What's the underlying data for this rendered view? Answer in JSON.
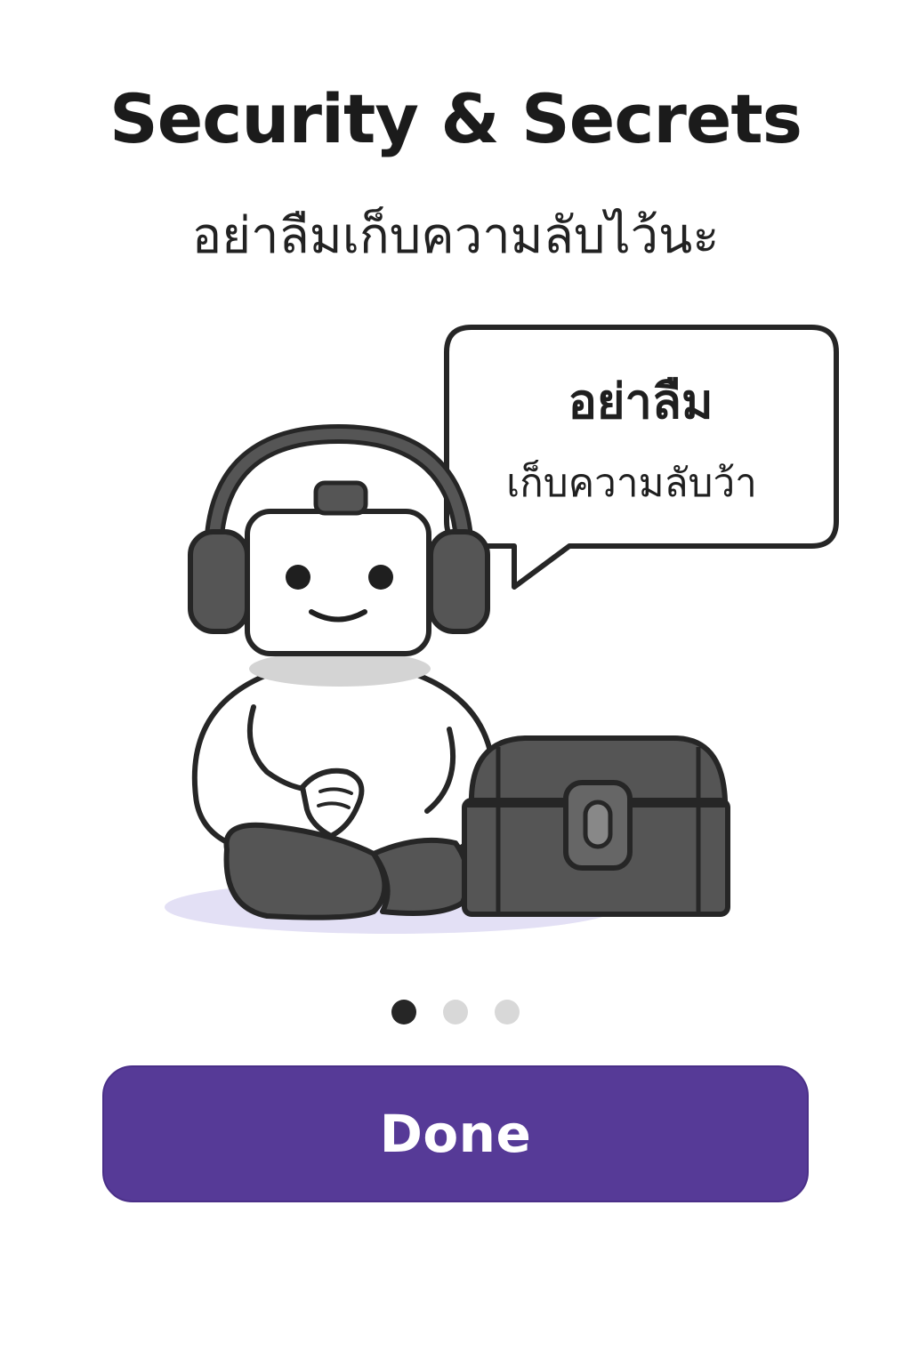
{
  "screen": {
    "title": "Security & Secrets",
    "subtitle": "อย่าลืมเก็บความลับไว้นะ"
  },
  "illustration": {
    "bubble_line_1": "อย่าลืม",
    "bubble_line_2": "เก็บความลับว้า",
    "icons": [
      "robot-character",
      "headphones-icon",
      "treasure-chest-icon",
      "speech-bubble"
    ]
  },
  "pagination": {
    "current": 1,
    "total": 3
  },
  "actions": {
    "done_label": "Done"
  },
  "colors": {
    "primary": "#563a97",
    "dot_active": "#262626",
    "dot_inactive": "#d8d8d8",
    "shadow": "#e3e0f5"
  }
}
